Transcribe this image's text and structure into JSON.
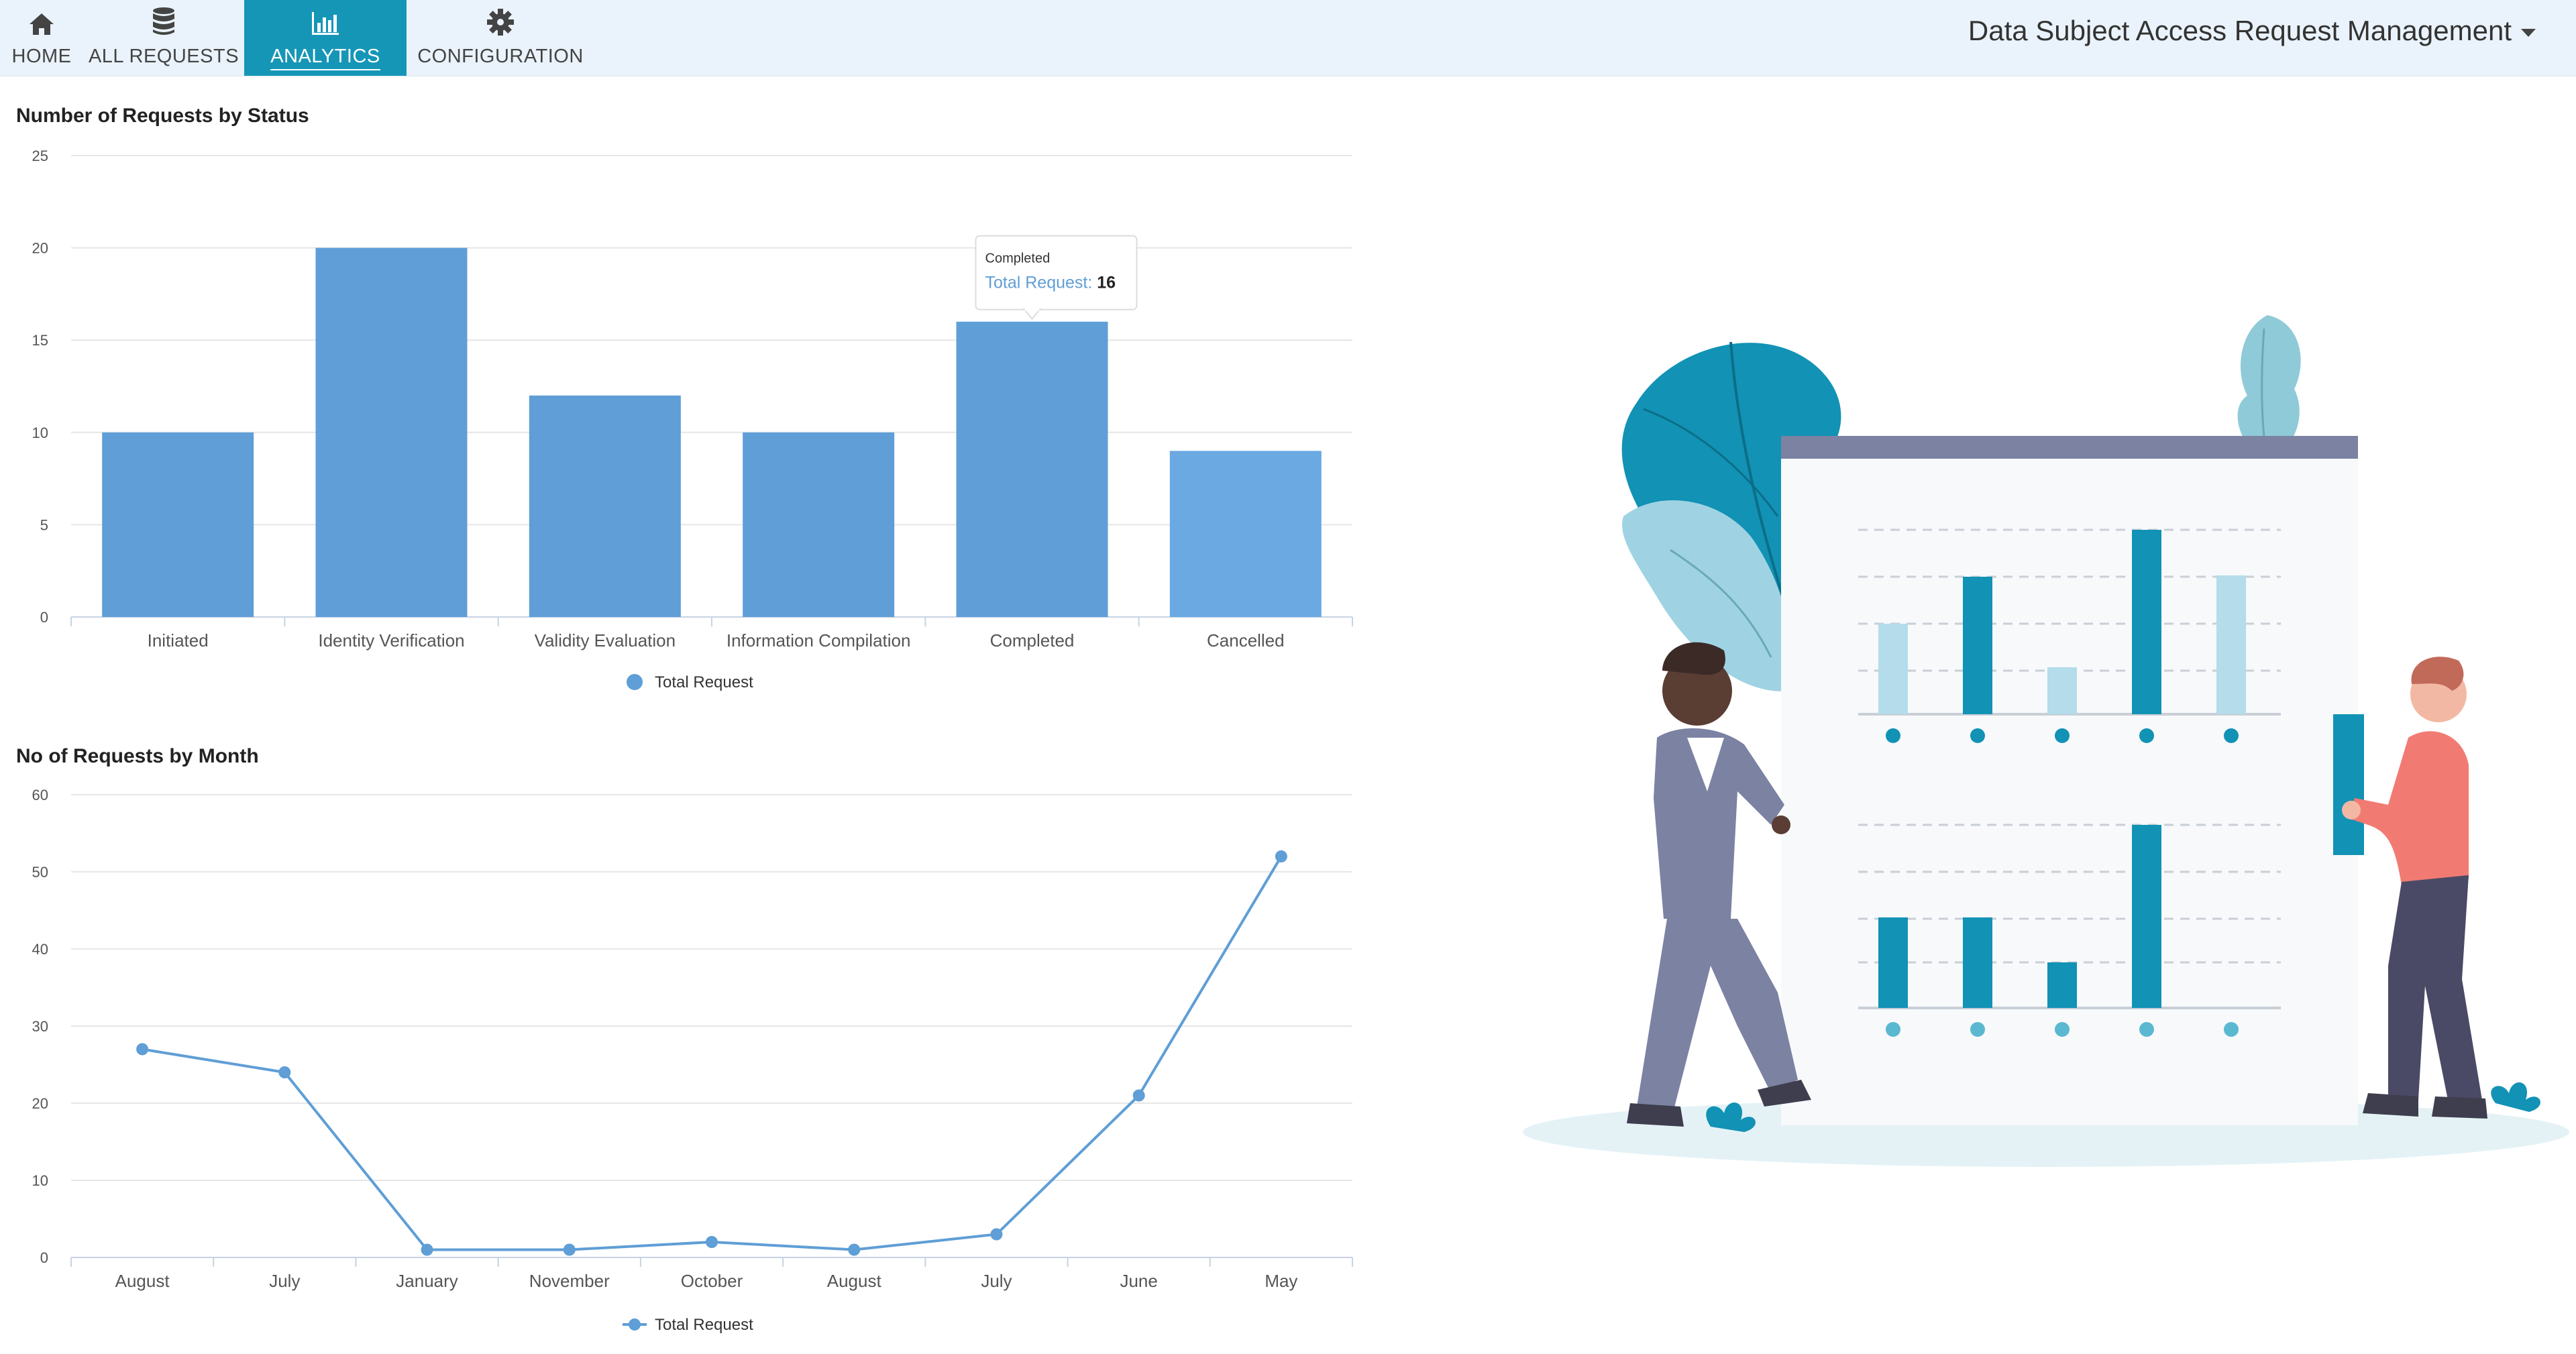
{
  "nav": {
    "items": [
      {
        "label": "HOME",
        "icon": "home-icon"
      },
      {
        "label": "ALL REQUESTS",
        "icon": "database-icon"
      },
      {
        "label": "ANALYTICS",
        "icon": "bar-chart-icon",
        "active": true
      },
      {
        "label": "CONFIGURATION",
        "icon": "gear-icon"
      }
    ],
    "app_title": "Data Subject Access Request Management"
  },
  "status_chart": {
    "title": "Number of Requests by Status",
    "legend": "Total Request",
    "tooltip": {
      "category": "Completed",
      "series": "Total Request:",
      "value": "16"
    }
  },
  "month_chart": {
    "title": "No of Requests by Month",
    "legend": "Total Request"
  },
  "colors": {
    "bar": "#5f9ed6",
    "bar_highlight": "#6ba9e3",
    "line": "#5f9ed6",
    "accent": "#1696b7",
    "nav_bg": "#eaf3fb"
  },
  "chart_data": [
    {
      "type": "bar",
      "title": "Number of Requests by Status",
      "categories": [
        "Initiated",
        "Identity Verification",
        "Validity Evaluation",
        "Information Compilation",
        "Completed",
        "Cancelled"
      ],
      "series": [
        {
          "name": "Total Request",
          "values": [
            10,
            20,
            12,
            10,
            16,
            9
          ]
        }
      ],
      "ylim": [
        0,
        25
      ],
      "yticks": [
        0,
        5,
        10,
        15,
        20,
        25
      ],
      "grid": true,
      "legend": "bottom"
    },
    {
      "type": "line",
      "title": "No of Requests by Month",
      "categories": [
        "August",
        "July",
        "January",
        "November",
        "October",
        "August",
        "July",
        "June",
        "May"
      ],
      "series": [
        {
          "name": "Total Request",
          "values": [
            27,
            24,
            1,
            1,
            2,
            1,
            3,
            21,
            52
          ]
        }
      ],
      "ylim": [
        0,
        60
      ],
      "yticks": [
        0,
        10,
        20,
        30,
        40,
        50,
        60
      ],
      "grid": true,
      "legend": "bottom"
    }
  ]
}
